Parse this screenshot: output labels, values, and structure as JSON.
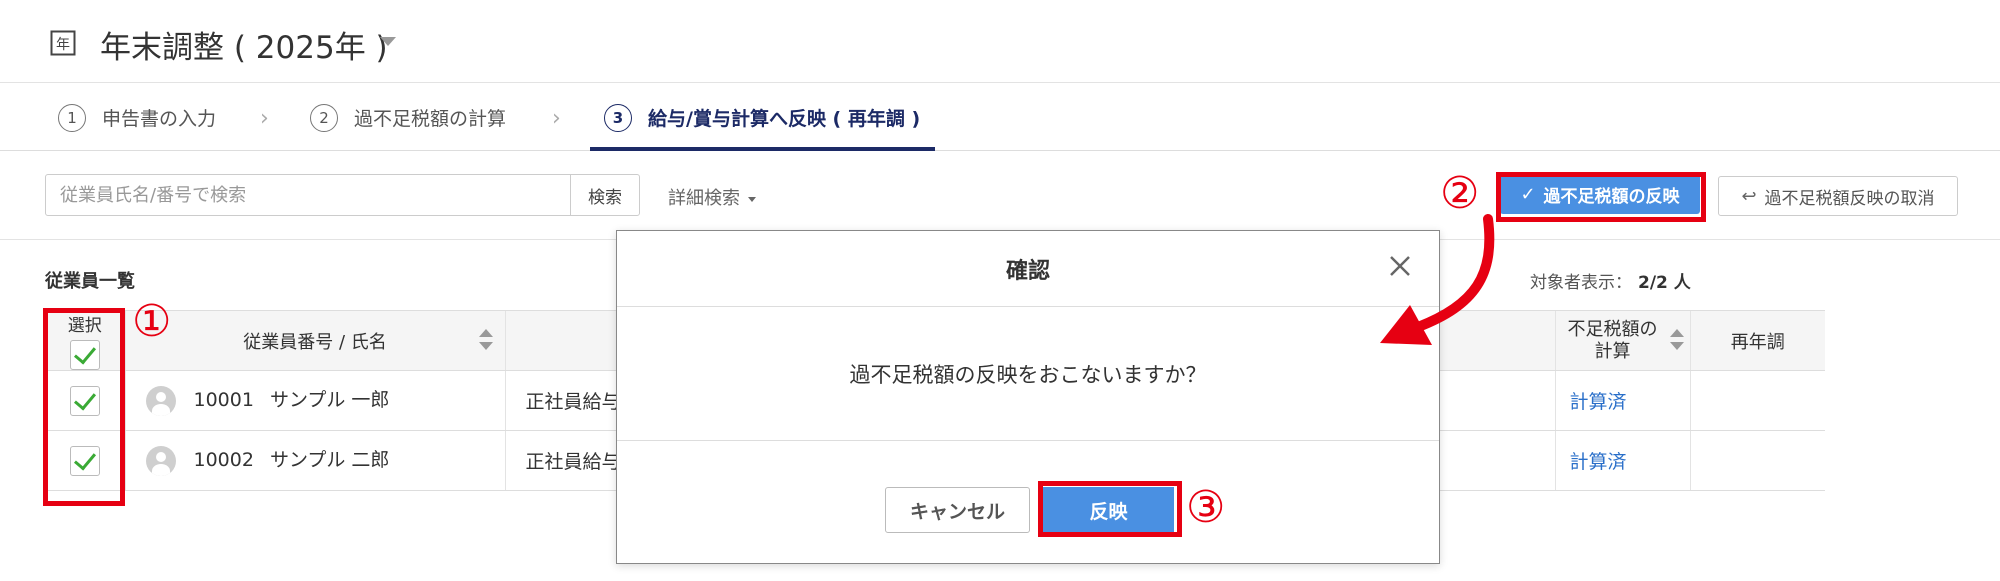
{
  "header": {
    "title": "年末調整 ( 2025年 )",
    "calendar_glyph": "年"
  },
  "steps": [
    {
      "num": "1",
      "label": "申告書の入力"
    },
    {
      "num": "2",
      "label": "過不足税額の計算"
    },
    {
      "num": "3",
      "label": "給与/賞与計算へ反映 ( 再年調 )"
    }
  ],
  "toolbar": {
    "search_placeholder": "従業員氏名/番号で検索",
    "search_label": "検索",
    "advanced_label": "詳細検索",
    "reflect_label": "過不足税額の反映",
    "cancel_reflect_label": "過不足税額反映の取消"
  },
  "list": {
    "title": "従業員一覧",
    "count_label": "対象者表示：",
    "count_value": "2/2 人",
    "columns": {
      "select": "選択",
      "name": "従業員番号 / 氏名",
      "calc_line1": "不足税額の",
      "calc_line2": "計算",
      "rechk": "再年調"
    },
    "rows": [
      {
        "id": "10001",
        "name": "サンプル 一郎",
        "type": "正社員給与",
        "calc": "計算済"
      },
      {
        "id": "10002",
        "name": "サンプル 二郎",
        "type": "正社員給与",
        "calc": "計算済"
      }
    ]
  },
  "dialog": {
    "title": "確認",
    "message": "過不足税額の反映をおこないますか？",
    "cancel_label": "キャンセル",
    "ok_label": "反映"
  },
  "annotations": {
    "n1": "①",
    "n2": "②",
    "n3": "③"
  },
  "colors": {
    "primary": "#4a90e2",
    "highlight": "#e60012",
    "active_step": "#1c2a66",
    "link": "#2a6fc9",
    "check": "#3aaa35"
  }
}
